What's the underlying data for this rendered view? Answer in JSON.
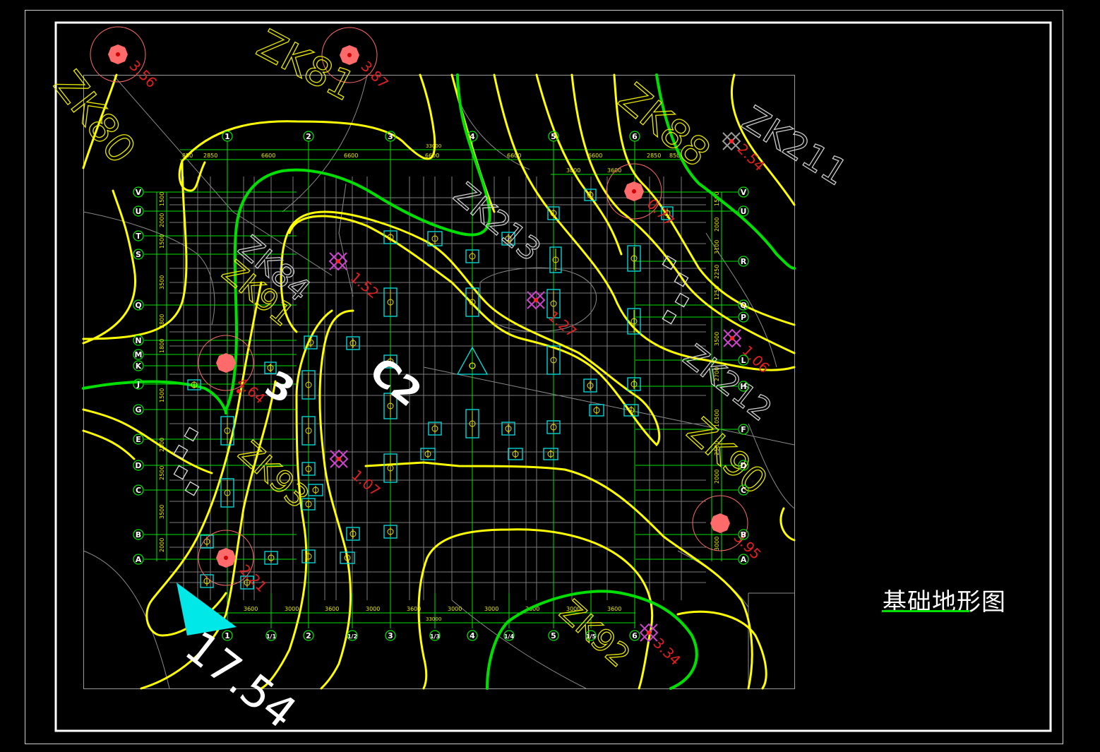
{
  "title": "基础地形图",
  "colors": {
    "background": "#000000",
    "frame": "#ffffff",
    "contour_main": "#ffff00",
    "contour_index": "#00e000",
    "grid": "#00e000",
    "pile": "#00e5e5",
    "borehole": "#ff6a6a",
    "probe": "#cc44cc",
    "terrain": "#8a8a8a"
  },
  "column_axes": [
    "1",
    "2",
    "3",
    "4",
    "5",
    "6"
  ],
  "bottom_axes": [
    "1",
    "1/1",
    "2",
    "1/2",
    "3",
    "1/3",
    "4",
    "1/4",
    "5",
    "1/5",
    "6"
  ],
  "row_axes_left": [
    "V",
    "U",
    "T",
    "S",
    "Q",
    "N",
    "M",
    "K",
    "J",
    "G",
    "E",
    "D",
    "C",
    "B",
    "A"
  ],
  "row_axes_right": [
    "V",
    "U",
    "R",
    "Q",
    "P",
    "L",
    "H",
    "F",
    "D",
    "C",
    "B",
    "A"
  ],
  "top_dims": [
    "850",
    "2850",
    "6600",
    "6600",
    "6600",
    "6600",
    "6600",
    "2850",
    "850"
  ],
  "top_total": "33000",
  "top_dims_2": [
    "3000",
    "3600"
  ],
  "bottom_dims": [
    "3600",
    "3000",
    "3600",
    "3000",
    "3600",
    "3000",
    "3000",
    "3600",
    "3000",
    "3600"
  ],
  "bottom_total": "33000",
  "left_dims": [
    "1500",
    "2000",
    "1500",
    "3500",
    "2800",
    "1800",
    "1500",
    "2500",
    "2500",
    "3500",
    "2000"
  ],
  "right_dims": [
    "1500",
    "2000",
    "3100",
    "2250",
    "1250",
    "3500",
    "2700",
    "10500",
    "2500",
    "2000",
    "3000"
  ],
  "boreholes": [
    {
      "label": "ZK80",
      "elev": "3.56"
    },
    {
      "label": "ZK81",
      "elev": "3.87"
    },
    {
      "label": "ZK88",
      "elev": "0.77"
    },
    {
      "label": "ZK211",
      "elev": "2.54"
    },
    {
      "label": "ZK213",
      "elev": ""
    },
    {
      "label": "ZK84",
      "elev": ""
    },
    {
      "label": "ZK91",
      "elev": "4.64"
    },
    {
      "label": "ZK212",
      "elev": "1.06"
    },
    {
      "label": "ZK90",
      "elev": "3.95"
    },
    {
      "label": "ZK93",
      "elev": "2.21"
    },
    {
      "label": "ZK92",
      "elev": "3.34"
    }
  ],
  "probe_elevs": [
    "1.52",
    "1.27",
    "1.07"
  ],
  "contour_labels": [
    "3",
    "C2"
  ],
  "spot_elevation": "17.54"
}
